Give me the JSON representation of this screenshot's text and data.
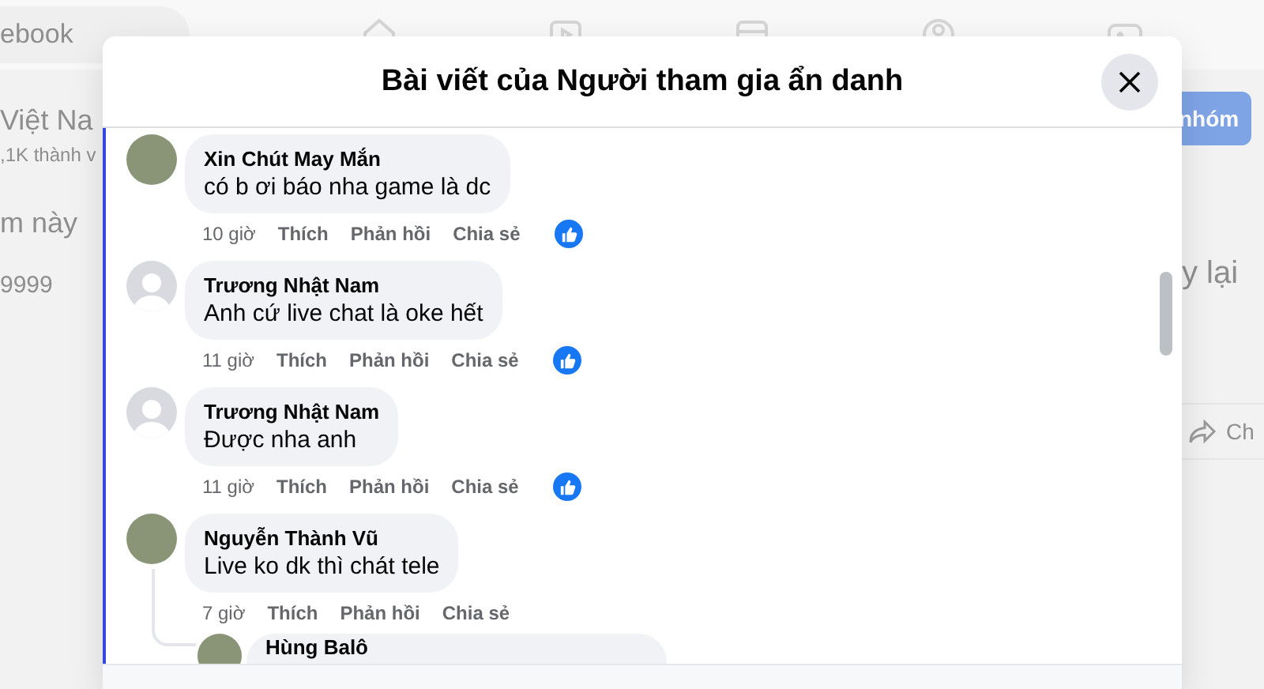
{
  "background": {
    "search_text": "ebook",
    "group_name": "Việt Na",
    "member_count": ",1K thành v",
    "texts": [
      "m này",
      "9999"
    ],
    "join_button": "nhóm",
    "side_text": "y lại",
    "share_label": "Ch"
  },
  "dialog": {
    "title": "Bài viết của Người tham gia ẩn danh",
    "comments": [
      {
        "author": "Xin Chút May Mắn",
        "text": "có b ơi báo nha game là dc",
        "time": "10 giờ",
        "actions": [
          "Thích",
          "Phản hồi",
          "Chia sẻ"
        ],
        "avatar": {
          "kind": "photo"
        },
        "has_like": true
      },
      {
        "author": "Trương Nhật Nam",
        "text": "Anh cứ live chat là oke hết",
        "time": "11 giờ",
        "actions": [
          "Thích",
          "Phản hồi",
          "Chia sẻ"
        ],
        "avatar": {
          "kind": "default"
        },
        "has_like": true
      },
      {
        "author": "Trương Nhật Nam",
        "text": "Được nha anh",
        "time": "11 giờ",
        "actions": [
          "Thích",
          "Phản hồi",
          "Chia sẻ"
        ],
        "avatar": {
          "kind": "default"
        },
        "has_like": true
      },
      {
        "author": "Nguyễn Thành Vũ",
        "text": "Live ko dk thì chát tele",
        "time": "7 giờ",
        "actions": [
          "Thích",
          "Phản hồi",
          "Chia sẻ"
        ],
        "avatar": {
          "kind": "photo"
        },
        "has_like": false,
        "replies": [
          {
            "author": "Hùng Balô",
            "avatar": {
              "kind": "photo"
            }
          }
        ]
      }
    ]
  }
}
